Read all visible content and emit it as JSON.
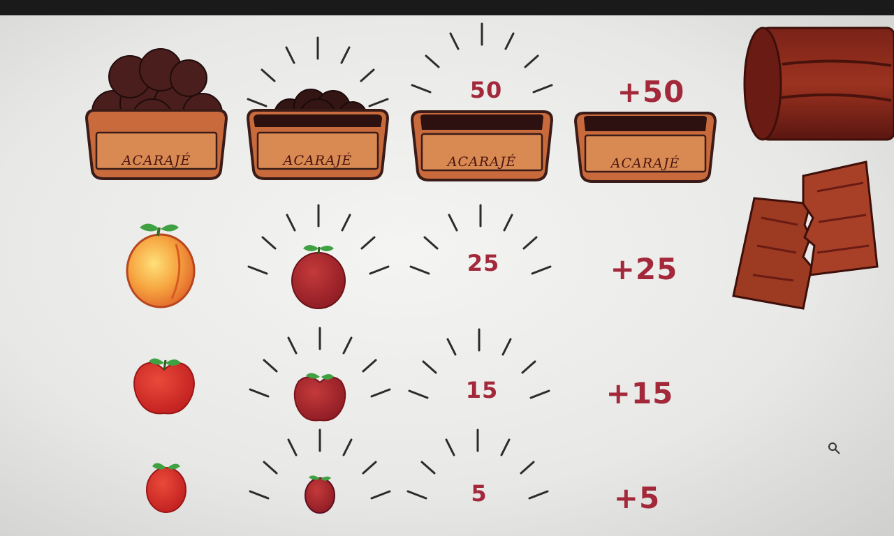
{
  "sprite_sheet": {
    "basket_label": "ACARAJÉ",
    "rows": [
      {
        "item": "acaraje-basket",
        "value": "50",
        "bonus": "+50"
      },
      {
        "item": "peach",
        "value": "25",
        "bonus": "+25"
      },
      {
        "item": "red-apple",
        "value": "15",
        "bonus": "+15"
      },
      {
        "item": "small-apple",
        "value": "5",
        "bonus": "+5"
      }
    ],
    "extras": [
      "wooden-log",
      "broken-log"
    ],
    "colors": {
      "score_red": "#a3283a",
      "basket_orange": "#c86a3c",
      "basket_dark": "#3a1b18",
      "wood_dark": "#5a1a14",
      "leaf_green": "#3fa142"
    }
  }
}
